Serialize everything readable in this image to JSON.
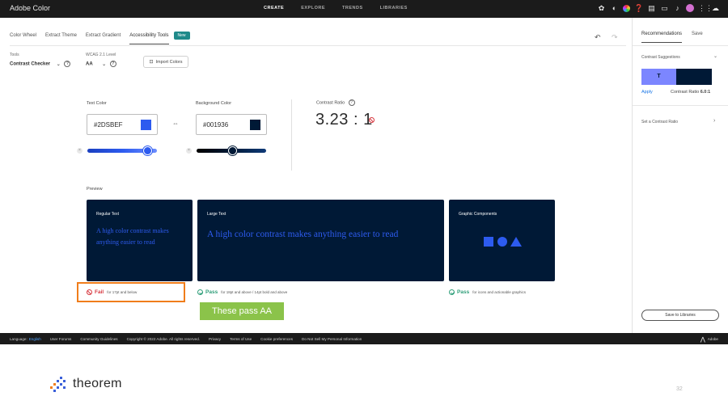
{
  "app": {
    "title": "Adobe Color",
    "nav": [
      "CREATE",
      "EXPLORE",
      "TRENDS",
      "LIBRARIES"
    ],
    "active_nav": "CREATE",
    "header_icons": [
      "settings-icon",
      "contrast-icon",
      "color-wheel-icon",
      "help-icon",
      "feedback-icon",
      "comment-icon",
      "notification-icon",
      "avatar",
      "apps-grid-icon",
      "creative-cloud-icon"
    ]
  },
  "tabs": {
    "items": [
      "Color Wheel",
      "Extract Theme",
      "Extract Gradient",
      "Accessibility Tools"
    ],
    "active": "Accessibility Tools",
    "badge": "New"
  },
  "tools": {
    "label": "Tools",
    "value": "Contrast Checker",
    "wcag_label": "WCAG 2.1 Level",
    "wcag_value": "AA",
    "import_label": "Import Colors"
  },
  "contrast": {
    "text_color_label": "Text Color",
    "text_color_hex": "#2DSBEF",
    "text_color_swatch": "#2d5bef",
    "bg_color_label": "Background Color",
    "bg_color_hex": "#001936",
    "bg_color_swatch": "#001936",
    "text_slider_level": 0.87,
    "bg_slider_level": 0.52,
    "ratio_label": "Contrast Ratio",
    "ratio_value": "3.23 : 1"
  },
  "preview": {
    "label": "Preview",
    "cards": [
      {
        "title": "Regular Text",
        "text": "A high color contrast makes anything easier to read"
      },
      {
        "title": "Large Text",
        "text": "A high color contrast makes anything easier to read"
      },
      {
        "title": "Graphic Components"
      }
    ],
    "results": [
      {
        "status": "Fail",
        "note": "for 17pt and below"
      },
      {
        "status": "Pass",
        "note": "for 18pt and above / 14pt bold and above"
      },
      {
        "status": "Pass",
        "note": "for icons and actionable graphics"
      }
    ]
  },
  "callout": "These pass AA",
  "recommendations": {
    "tabs": [
      "Recommendations",
      "Save"
    ],
    "active": "Recommendations",
    "suggestions_label": "Contrast Suggestions",
    "sample_letter": "T",
    "apply_label": "Apply",
    "ratio_text": "Contrast Ratio",
    "ratio_value": "6.0:1",
    "set_ratio_label": "Set a Contrast Ratio",
    "save_libraries": "Save to Libraries"
  },
  "footer": {
    "language_label": "Language:",
    "language_value": "English",
    "links": [
      "User Forums",
      "Community Guidelines",
      "Copyright © 2022 Adobe. All rights reserved.",
      "Privacy",
      "Terms of Use",
      "Cookie preferences",
      "Do Not Sell My Personal Information"
    ],
    "brand": "Adobe"
  },
  "slide": {
    "logo_text": "theorem",
    "page_number": "32"
  },
  "colors": {
    "fail": "#d7373f",
    "pass": "#2d9d78",
    "highlight": "#f07d1b",
    "callout_bg": "#8bc34a",
    "dark_bar": "#1b1b1b"
  }
}
